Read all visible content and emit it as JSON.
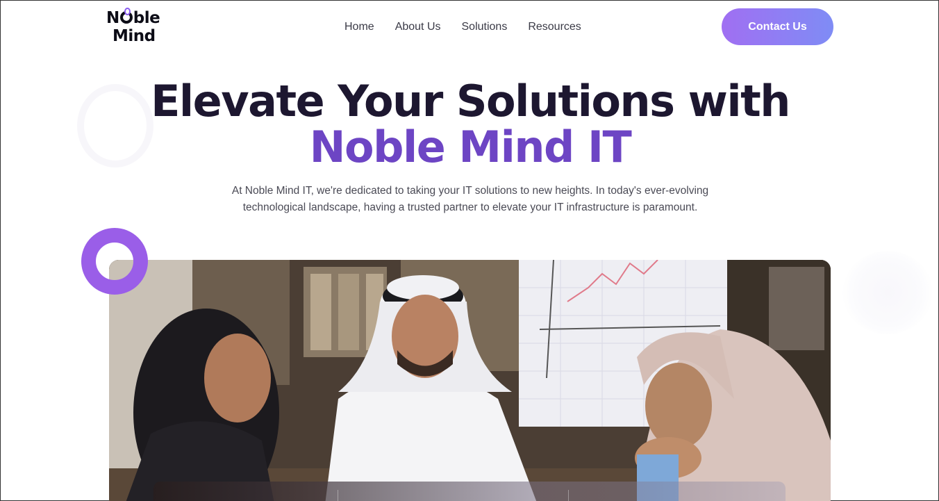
{
  "brand": {
    "logo_line1_a": "N",
    "logo_line1_b": "ble",
    "logo_line2": "Mind",
    "accent_color": "#6d45c4",
    "button_gradient": [
      "#a06ff2",
      "#7f8cf5"
    ]
  },
  "nav": {
    "items": [
      {
        "label": "Home"
      },
      {
        "label": "About Us"
      },
      {
        "label": "Solutions"
      },
      {
        "label": "Resources"
      }
    ],
    "contact_label": "Contact Us"
  },
  "hero": {
    "title_line1": "Elevate Your Solutions with",
    "title_line2": "Noble Mind IT",
    "description_line1": "At Noble Mind IT, we're dedicated to taking your IT solutions to new heights. In today's ever-evolving",
    "description_line2": "technological landscape, having a trusted partner to elevate your IT infrastructure is paramount.",
    "image_subject": "three-colleagues-meeting-photo"
  }
}
